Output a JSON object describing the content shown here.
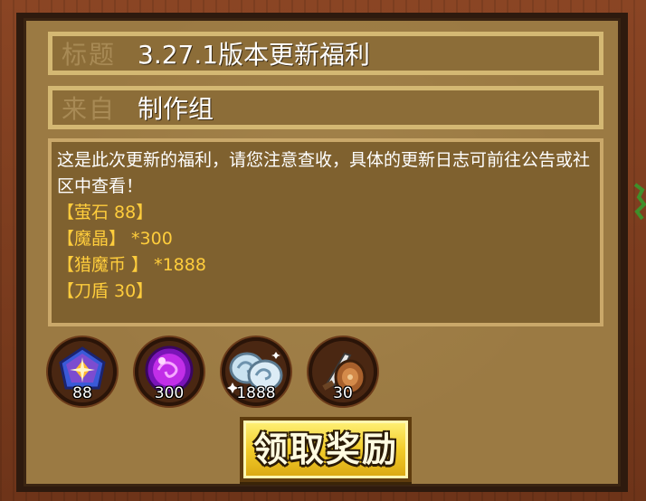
{
  "header": {
    "title_label": "标题",
    "title_value": "3.27.1版本更新福利",
    "from_label": "来自",
    "from_value": "制作组"
  },
  "message": {
    "body": "这是此次更新的福利，请您注意查收，具体的更新日志可前往公告或社区中查看！",
    "rewards": [
      "【萤石 88】",
      "【魔晶】 *300",
      "【猎魔币 】 *1888",
      "【刀盾 30】"
    ]
  },
  "items": [
    {
      "icon": "fluorite-gem-icon",
      "count": "88"
    },
    {
      "icon": "magic-crystal-icon",
      "count": "300"
    },
    {
      "icon": "hunter-coin-icon",
      "count": "1888"
    },
    {
      "icon": "blade-shield-icon",
      "count": "30"
    }
  ],
  "actions": {
    "claim_label": "领取奖励"
  },
  "colors": {
    "board": "#9b7a43",
    "frame": "#8a4524",
    "reward_text": "#ffcd3c",
    "button": "#f2cc2a"
  }
}
